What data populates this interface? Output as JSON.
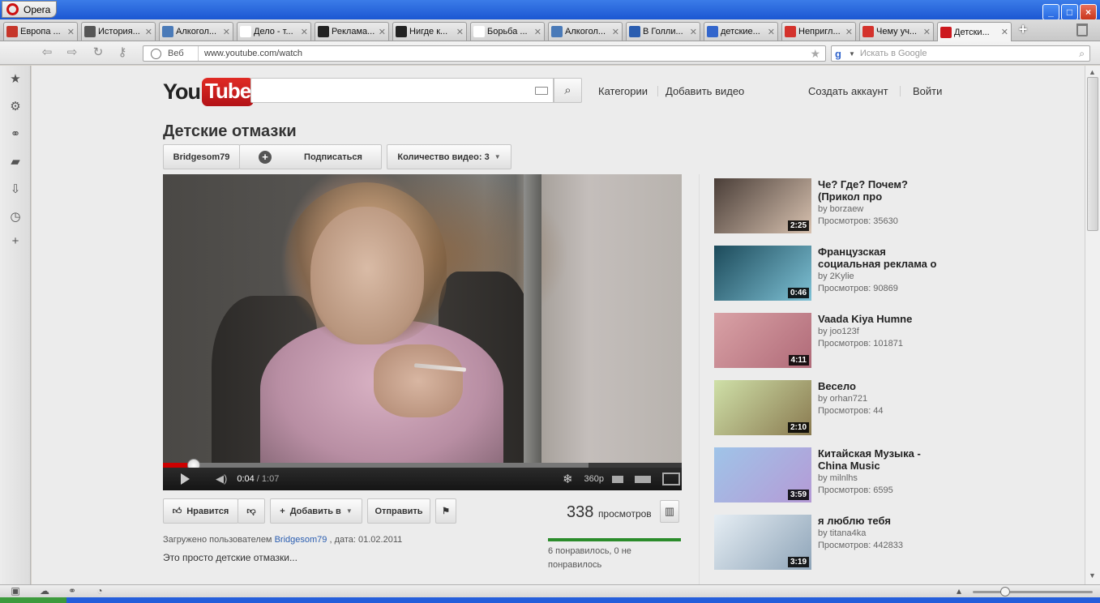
{
  "window": {
    "app_button": "Opera"
  },
  "tabs": [
    {
      "label": "Европа ...",
      "icon": "opera-red-icon",
      "color": "#c6362a"
    },
    {
      "label": "История...",
      "icon": "history-site-icon",
      "color": "#555555"
    },
    {
      "label": "Алкогол...",
      "icon": "globe-icon",
      "color": "#4a7ab8"
    },
    {
      "label": "Дело - т...",
      "icon": "blank-page-icon",
      "color": "#ffffff"
    },
    {
      "label": "Реклама...",
      "icon": "ad-site-icon",
      "color": "#222222"
    },
    {
      "label": "Нигде к...",
      "icon": "ad-site-icon",
      "color": "#222222"
    },
    {
      "label": "Борьба ...",
      "icon": "wikipedia-icon",
      "color": "#ffffff"
    },
    {
      "label": "Алкогол...",
      "icon": "globe-icon",
      "color": "#4a7ab8"
    },
    {
      "label": "В Голли...",
      "icon": "news-icon",
      "color": "#2a5db0"
    },
    {
      "label": "детские...",
      "icon": "google-icon",
      "color": "#3366cc"
    },
    {
      "label": "Непригл...",
      "icon": "s-site-icon",
      "color": "#d4322c"
    },
    {
      "label": "Чему уч...",
      "icon": "channel5-icon",
      "color": "#d4322c"
    },
    {
      "label": "Детски...",
      "icon": "youtube-icon",
      "color": "#cc181e"
    }
  ],
  "address": {
    "web_label": "Веб",
    "url": "www.youtube.com/watch",
    "search_placeholder": "Искать в Google"
  },
  "youtube": {
    "logo_you": "You",
    "logo_tube": "Tube",
    "nav": {
      "categories": "Категории",
      "upload": "Добавить видео",
      "create_account": "Создать аккаунт",
      "sign_in": "Войти"
    },
    "video_title": "Детские отмазки",
    "channel": "Bridgesom79",
    "subscribe": "Подписаться",
    "video_count": "Количество видео: 3",
    "player": {
      "current_time": "0:04",
      "separator": " / ",
      "duration": "1:07",
      "quality": "360p",
      "progress_fraction": 0.06,
      "buffered_fraction": 0.82
    },
    "actions": {
      "like": "Нравится",
      "add_to": "Добавить в",
      "share": "Отправить"
    },
    "views_count": "338",
    "views_label": "просмотров",
    "uploaded_prefix": "Загружено пользователем",
    "uploaded_user": "Bridgesom79",
    "uploaded_date": ", дата: 01.02.2011",
    "description": "Это просто детские отмазки...",
    "likes_line1": "6 понравилось, 0 не",
    "likes_line2": "понравилось"
  },
  "related": [
    {
      "title": "Че? Где? Почем? (Прикол про",
      "by": "by borzaew",
      "views": "Просмотров: 35630",
      "duration": "2:25",
      "thumb_colors": [
        "#4a3e38",
        "#d8c2b0"
      ]
    },
    {
      "title": "Французская социальная реклама о",
      "by": "by 2Kylie",
      "views": "Просмотров: 90869",
      "duration": "0:46",
      "thumb_colors": [
        "#1c4a5a",
        "#7fc2d6"
      ]
    },
    {
      "title": "Vaada Kiya Humne",
      "by": "by joo123f",
      "views": "Просмотров: 101871",
      "duration": "4:11",
      "thumb_colors": [
        "#d9a2a6",
        "#b06a78"
      ]
    },
    {
      "title": "Весело",
      "by": "by orhan721",
      "views": "Просмотров: 44",
      "duration": "2:10",
      "thumb_colors": [
        "#cfe0a8",
        "#8a7a50"
      ]
    },
    {
      "title": "Китайская Музыка - China Music",
      "by": "by milnlhs",
      "views": "Просмотров: 6595",
      "duration": "3:59",
      "thumb_colors": [
        "#9fc4e8",
        "#b59ad6"
      ]
    },
    {
      "title": "я люблю тебя",
      "by": "by titana4ka",
      "views": "Просмотров: 442833",
      "duration": "3:19",
      "thumb_colors": [
        "#e6eef4",
        "#8ea4b8"
      ]
    }
  ]
}
